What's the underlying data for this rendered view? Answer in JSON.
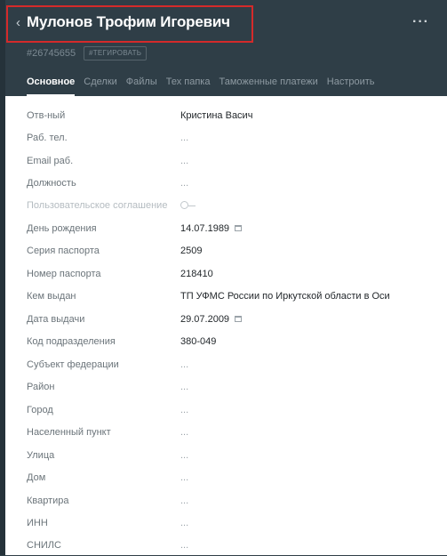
{
  "header": {
    "title": "Мулонов Трофим Игоревич",
    "back_icon": "chevron-left-icon",
    "more_icon": "more-dots-icon",
    "more_label": "···",
    "id_text": "#26745655",
    "tag_button": "#ТЕГИРОВАТЬ"
  },
  "tabs": [
    {
      "label": "Основное",
      "active": true
    },
    {
      "label": "Сделки",
      "active": false
    },
    {
      "label": "Файлы",
      "active": false
    },
    {
      "label": "Тех папка",
      "active": false
    },
    {
      "label": "Таможенные платежи",
      "active": false
    },
    {
      "label": "Настроить",
      "active": false
    }
  ],
  "fields": [
    {
      "label": "Отв-ный",
      "value": "Кристина Васич"
    },
    {
      "label": "Раб. тел.",
      "value": "..."
    },
    {
      "label": "Email раб.",
      "value": "..."
    },
    {
      "label": "Должность",
      "value": "..."
    },
    {
      "label": "Пользовательское соглашение",
      "value": "",
      "toggle": "off"
    },
    {
      "label": "День рождения",
      "value": "14.07.1989",
      "calendar": true
    },
    {
      "label": "Серия паспорта",
      "value": "2509"
    },
    {
      "label": "Номер паспорта",
      "value": "218410"
    },
    {
      "label": "Кем выдан",
      "value": "ТП УФМС России по Иркутской области в Оси"
    },
    {
      "label": "Дата выдачи",
      "value": "29.07.2009",
      "calendar": true
    },
    {
      "label": "Код подразделения",
      "value": "380-049"
    },
    {
      "label": "Субъект федерации",
      "value": "..."
    },
    {
      "label": "Район",
      "value": "..."
    },
    {
      "label": "Город",
      "value": "..."
    },
    {
      "label": "Населенный пункт",
      "value": "..."
    },
    {
      "label": "Улица",
      "value": "..."
    },
    {
      "label": "Дом",
      "value": "..."
    },
    {
      "label": "Квартира",
      "value": "..."
    },
    {
      "label": "ИНН",
      "value": "..."
    },
    {
      "label": "СНИЛС",
      "value": "..."
    }
  ],
  "colors": {
    "header_bg": "#2f3e47",
    "highlight_border": "#d42a2a",
    "panel_bg": "#ffffff"
  }
}
